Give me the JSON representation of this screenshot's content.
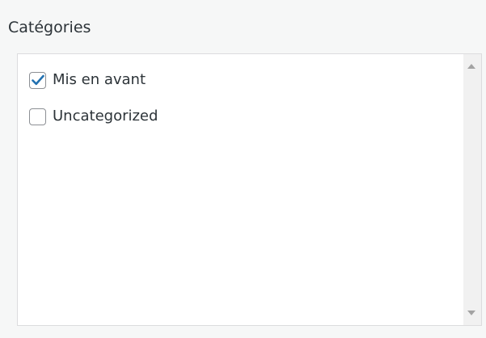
{
  "panel": {
    "title": "Catégories"
  },
  "categories": [
    {
      "label": "Mis en avant",
      "checked": true
    },
    {
      "label": "Uncategorized",
      "checked": false
    }
  ],
  "colors": {
    "checkmark": "#2271b1",
    "checkbox_border": "#8c8f94",
    "text": "#2c3338"
  }
}
